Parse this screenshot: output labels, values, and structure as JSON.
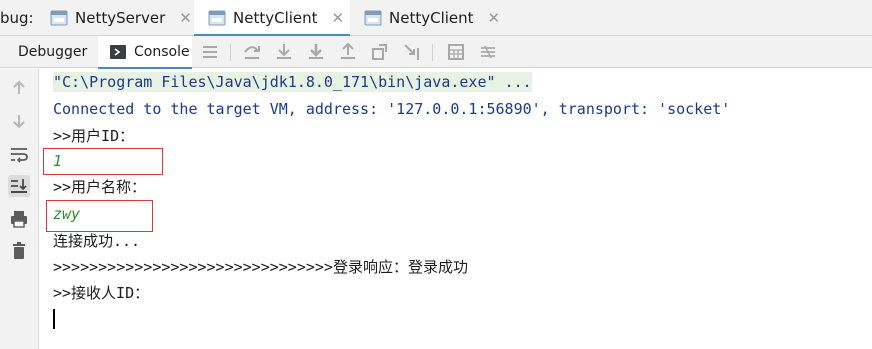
{
  "window": {
    "tab_prefix": "bug:",
    "run_tabs": [
      {
        "label": "NettyServer",
        "active": false
      },
      {
        "label": "NettyClient",
        "active": true
      },
      {
        "label": "NettyClient",
        "active": false
      }
    ],
    "close_glyph": "✕"
  },
  "toolbar": {
    "debugger_label": "Debugger",
    "console_label": "Console",
    "icons": [
      "show-execution-point-icon",
      "step-over-icon",
      "step-into-icon",
      "force-step-into-icon",
      "step-out-icon",
      "drop-frame-icon",
      "run-to-cursor-icon",
      "evaluate-expression-icon",
      "trace-current-stream-icon"
    ]
  },
  "gutter": {
    "icons": [
      "up-arrow-icon",
      "down-arrow-icon",
      "soft-wrap-icon",
      "scroll-to-end-icon",
      "print-icon",
      "trash-icon"
    ]
  },
  "console": {
    "lines": [
      "\"C:\\Program Files\\Java\\jdk1.8.0_171\\bin\\java.exe\" ...",
      "Connected to the target VM, address: '127.0.0.1:56890', transport: 'socket'",
      ">>用户ID：",
      "1",
      ">>用户名称：",
      "zwy",
      "连接成功...",
      ">>>>>>>>>>>>>>>>>>>>>>>>>>>>>>>登录响应：登录成功",
      ">>接收人ID："
    ]
  },
  "colors": {
    "panel_bg": "#f2f2f2",
    "accent": "#4a88c7",
    "command_line_bg": "#e8f2e2",
    "system_text": "#1a3a8f",
    "user_input_text": "#2f8f2f",
    "highlight_box": "#d93b3b"
  }
}
